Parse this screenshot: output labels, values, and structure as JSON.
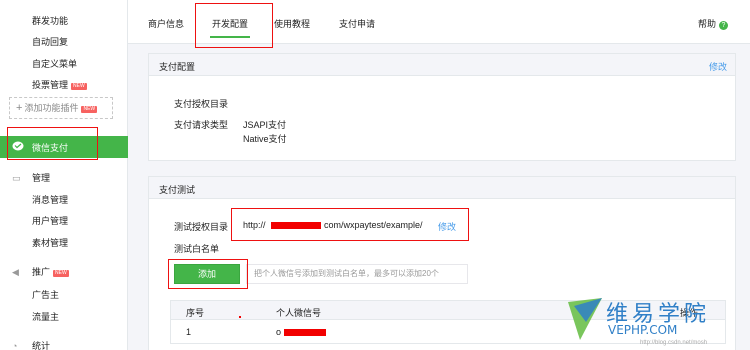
{
  "sidebar": {
    "items": [
      "群发功能",
      "自动回复",
      "自定义菜单",
      "投票管理"
    ],
    "vote_badge": "NEW",
    "add_plugin": "添加功能插件",
    "add_plugin_badge": "NEW",
    "wxpay": "微信支付",
    "groups": [
      {
        "title": "管理",
        "items": [
          "消息管理",
          "用户管理",
          "素材管理"
        ]
      },
      {
        "title": "推广",
        "badge": "NEW",
        "items": [
          "广告主",
          "流量主"
        ]
      },
      {
        "title": "统计"
      }
    ]
  },
  "tabs": [
    "商户信息",
    "开发配置",
    "使用教程",
    "支付申请"
  ],
  "active_tab": "开发配置",
  "help": {
    "label": "帮助",
    "icon": "?"
  },
  "pay_config": {
    "title": "支付配置",
    "edit": "修改",
    "auth_dir_label": "支付授权目录",
    "request_type_label": "支付请求类型",
    "request_types": [
      "JSAPI支付",
      "Native支付"
    ]
  },
  "pay_test": {
    "title": "支付测试",
    "test_dir_label": "测试授权目录",
    "test_dir_prefix": "http://",
    "test_dir_suffix": "com/wxpaytest/example/",
    "test_dir_edit": "修改",
    "whitelist_label": "测试白名单",
    "add_button": "添加",
    "whitelist_placeholder": "把个人微信号添加到测试白名单，最多可以添加20个",
    "table_headers": [
      "序号",
      "个人微信号",
      "操作"
    ],
    "rows": [
      {
        "index": "1",
        "wechat_prefix": "o"
      }
    ]
  },
  "watermark": {
    "cn": "维易学院",
    "en": "VEPHP.COM",
    "url": "http://blog.csdn.net/mosh"
  },
  "colors": {
    "accent": "#44b549",
    "link": "#459ae9",
    "highlight": "#e11111"
  }
}
